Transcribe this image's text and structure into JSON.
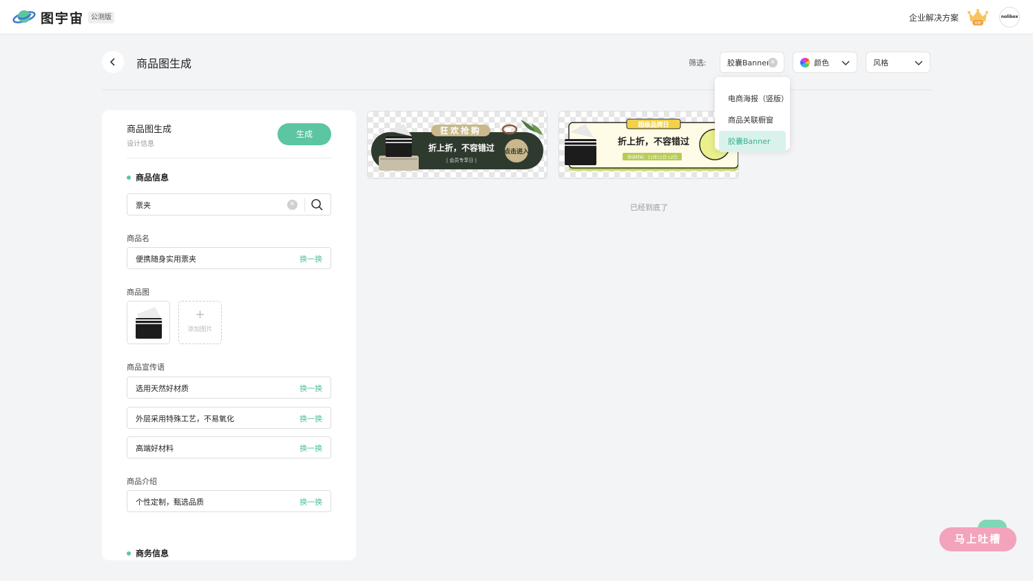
{
  "header": {
    "logo_text": "图宇宙",
    "beta_badge": "公测版",
    "enterprise_link": "企业解决方案",
    "vip_label": "VIP",
    "avatar_text": "nolibox"
  },
  "page": {
    "title": "商品图生成",
    "filter_label": "筛选:",
    "filter_type": "胶囊Banner",
    "filter_color": "颜色",
    "filter_style": "风格",
    "end_text": "已经到底了"
  },
  "dropdown": {
    "items": [
      "电商海报（竖版）",
      "商品关联橱窗",
      "胶囊Banner"
    ],
    "active_index": 2
  },
  "panel": {
    "title": "商品图生成",
    "subtitle": "设计信息",
    "generate_label": "生成",
    "section_product_info": "商品信息",
    "search_value": "票夹",
    "name_label": "商品名",
    "name_value": "便携随身实用票夹",
    "swap_label": "换一换",
    "image_label": "商品图",
    "add_image_label": "添加图片",
    "slogan_label": "商品宣传语",
    "slogans": [
      "选用天然好材质",
      "外层采用特殊工艺，不易氧化",
      "高端好材料"
    ],
    "intro_label": "商品介绍",
    "intro_value": "个性定制，甄选品质",
    "section_business_info": "商务信息"
  },
  "cards": [
    {
      "top_tag": "狂欢抢购",
      "headline": "折上折，不容错过",
      "sub": "| 会员专享日 |",
      "cta": "点击进入"
    },
    {
      "top_tag": "超级品牌日",
      "headline": "折上折，不容错过",
      "sub": "活动时间：11月11日-12日"
    }
  ],
  "feedback": {
    "label": "马上吐槽"
  },
  "colors": {
    "accent": "#5cc5a2",
    "accent_light": "#d9f3ec",
    "feedback": "#f4a3bd"
  }
}
